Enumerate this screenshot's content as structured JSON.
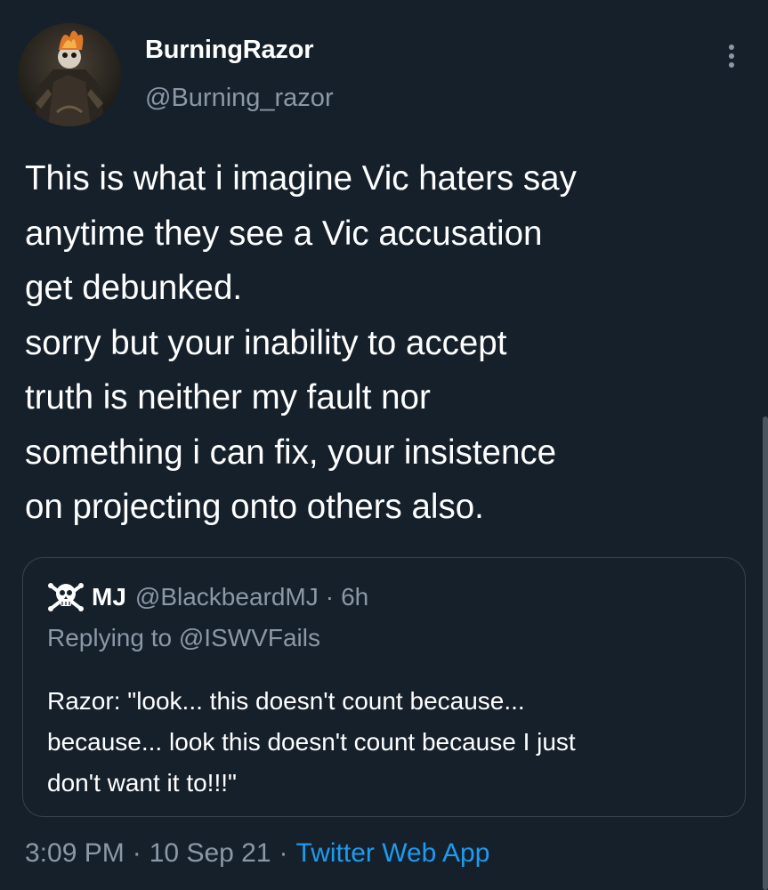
{
  "author": {
    "display_name": "BurningRazor",
    "handle": "@Burning_razor",
    "avatar_icon": "ghost-rider-avatar"
  },
  "tweet": {
    "text_lines": [
      "This is what i imagine Vic haters say",
      "anytime they see a Vic accusation",
      "get debunked.",
      "sorry but your inability to accept",
      "truth is neither my fault nor",
      "something i can fix, your insistence",
      "on projecting onto others also."
    ]
  },
  "quote": {
    "name": "MJ",
    "handle": "@BlackbeardMJ",
    "separator": "·",
    "time": "6h",
    "reply_prefix": "Replying to",
    "reply_to": "@ISWVFails",
    "text_lines": [
      "Razor: \"look... this doesn't count because...",
      "because... look this doesn't count because I just",
      "don't want it to!!!\""
    ],
    "avatar_icon": "jolly-roger-avatar"
  },
  "meta": {
    "time": "3:09 PM",
    "separator": "·",
    "date": "10 Sep 21",
    "source": "Twitter Web App"
  },
  "colors": {
    "background": "#15202b",
    "text_primary": "#ffffff",
    "text_secondary": "#8b98a5",
    "accent": "#1d9bf0",
    "border": "#38444d"
  }
}
